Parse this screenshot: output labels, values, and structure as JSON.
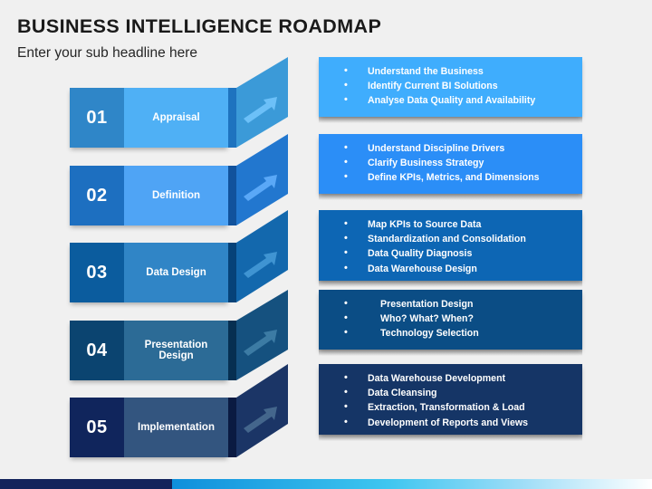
{
  "header": {
    "title": "BUSINESS INTELLIGENCE ROADMAP",
    "subtitle": "Enter your sub headline here"
  },
  "colors": {
    "background": "#f0f0f0",
    "title_text": "#1a1a1a",
    "bullet_text": "#ffffff",
    "bar_navy": "#13235b",
    "bar_gradient_start": "#0f8fdb",
    "bar_gradient_mid": "#3ec6f0",
    "bar_gradient_end": "#ffffff"
  },
  "rows": [
    {
      "number": "01",
      "name": "Appraisal",
      "num_color": "#2f86c8",
      "name_color": "#4fb0f5",
      "connector_color": "#3b9ad8",
      "connector_side_color": "#1e73bf",
      "arrow_color": "#6cc0f8",
      "panel_color": "#3fadfd",
      "indent": false,
      "bullets": [
        "Understand the Business",
        "Identify Current BI Solutions",
        "Analyse Data Quality and Availability"
      ]
    },
    {
      "number": "02",
      "name": "Definition",
      "num_color": "#1d6fc0",
      "name_color": "#4fa4f5",
      "connector_color": "#2277cf",
      "connector_side_color": "#11529c",
      "arrow_color": "#5aa8f7",
      "panel_color": "#2b8ef7",
      "indent": false,
      "bullets": [
        "Understand Discipline Drivers",
        "Clarify Business Strategy",
        "Define KPIs, Metrics, and Dimensions"
      ]
    },
    {
      "number": "03",
      "name": "Data Design",
      "num_color": "#0b5c9e",
      "name_color": "#3085c6",
      "connector_color": "#1368ad",
      "connector_side_color": "#064278",
      "arrow_color": "#3f94d2",
      "panel_color": "#0d66b4",
      "indent": false,
      "bullets": [
        "Map KPIs to Source Data",
        "Standardization and Consolidation",
        "Data Quality Diagnosis",
        "Data Warehouse Design"
      ]
    },
    {
      "number": "04",
      "name": "Presentation Design",
      "num_color": "#0b4470",
      "name_color": "#2c6b96",
      "connector_color": "#15517f",
      "connector_side_color": "#062f51",
      "arrow_color": "#3c7ba4",
      "panel_color": "#0b4d85",
      "indent": true,
      "bullets": [
        "Presentation Design",
        "Who?  What? When?",
        "Technology Selection"
      ]
    },
    {
      "number": "05",
      "name": "Implementation",
      "num_color": "#10255c",
      "name_color": "#33557f",
      "connector_color": "#1b3566",
      "connector_side_color": "#0a1a42",
      "arrow_color": "#44668c",
      "panel_color": "#153566",
      "indent": false,
      "bullets": [
        "Data Warehouse Development",
        "Data Cleansing",
        "Extraction, Transformation & Load",
        "Development of Reports and Views"
      ]
    }
  ]
}
